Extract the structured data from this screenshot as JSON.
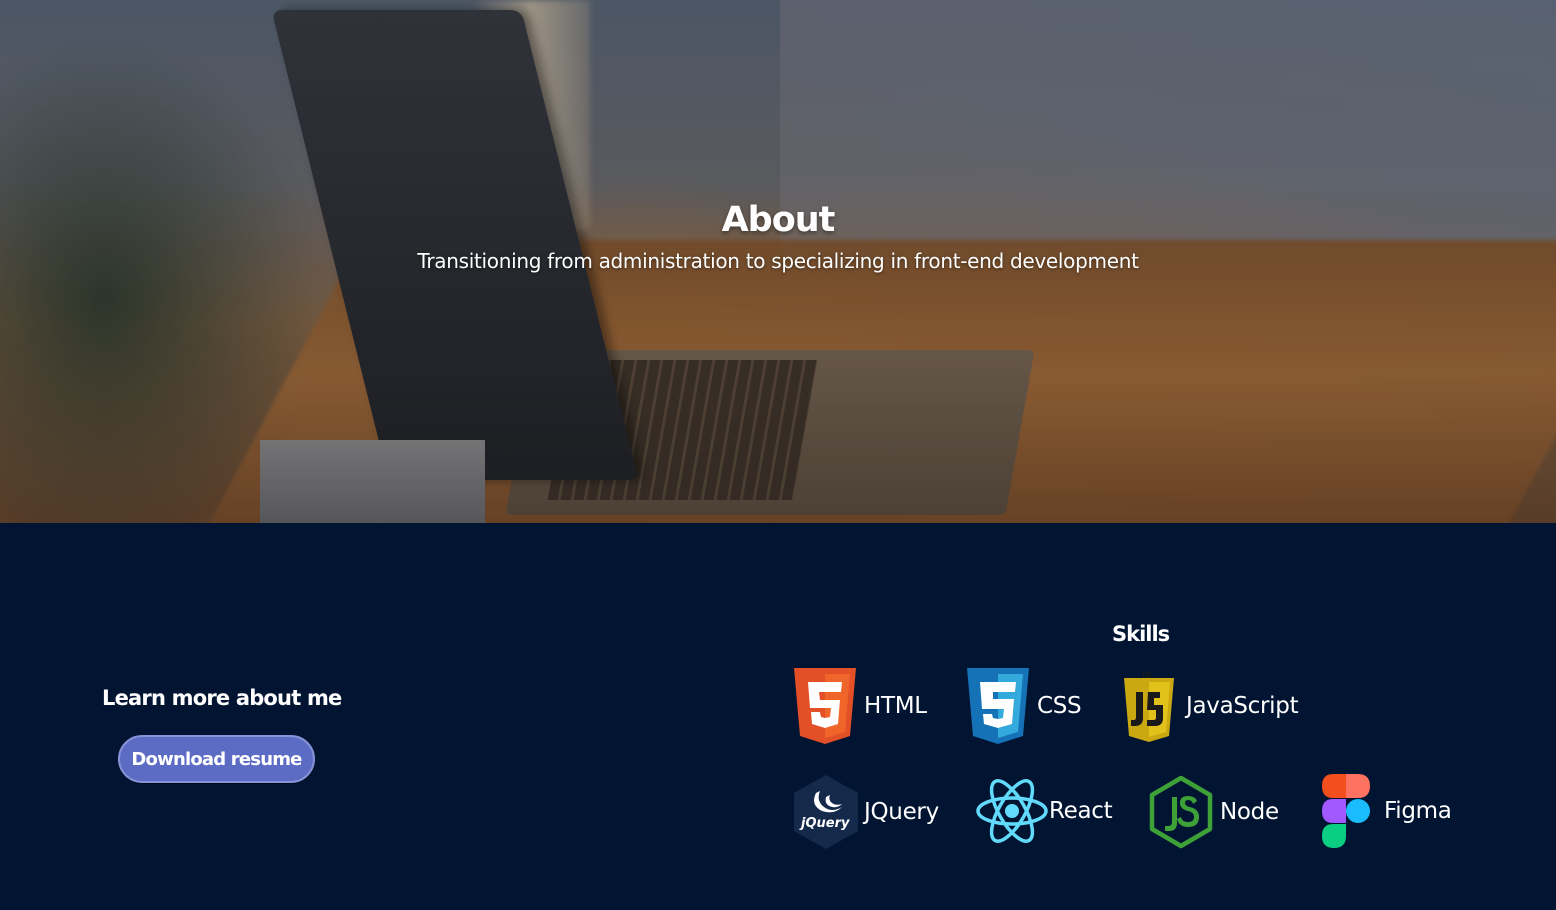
{
  "hero": {
    "title": "About",
    "subtitle": "Transitioning from administration to specializing in front-end development"
  },
  "about": {
    "heading": "Learn more about me",
    "download_label": "Download resume"
  },
  "skills": {
    "title": "Skills",
    "items": [
      {
        "label": "HTML",
        "icon": "html5-icon",
        "color": "#e34f26"
      },
      {
        "label": "CSS",
        "icon": "css3-icon",
        "color": "#1572b6"
      },
      {
        "label": "JavaScript",
        "icon": "javascript-icon",
        "color": "#c9a812"
      },
      {
        "label": "JQuery",
        "icon": "jquery-icon",
        "color": "#0e2246"
      },
      {
        "label": "React",
        "icon": "react-icon",
        "color": "#61dafb"
      },
      {
        "label": "Node",
        "icon": "nodejs-icon",
        "color": "#3ea138"
      },
      {
        "label": "Figma",
        "icon": "figma-icon",
        "color": "#a259ff"
      }
    ]
  },
  "colors": {
    "background": "#011432",
    "button": "#5c6cc4"
  }
}
